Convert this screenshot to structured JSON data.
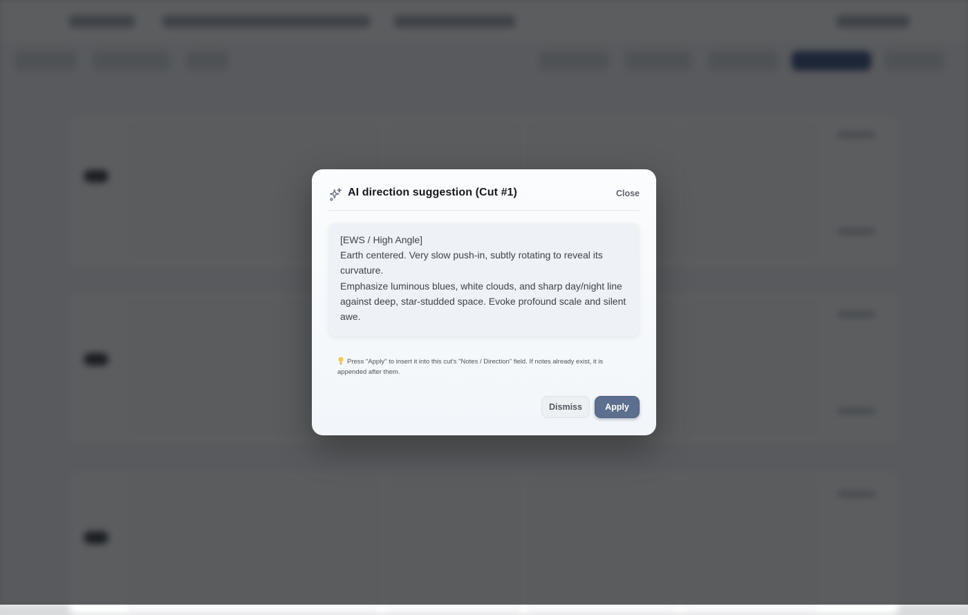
{
  "dialog": {
    "title": "AI direction suggestion (Cut #1)",
    "close_label": "Close",
    "suggestion_lines": [
      "[EWS / High Angle]",
      "Earth centered. Very slow push-in, subtly rotating to reveal its curvature.",
      "Emphasize luminous blues, white clouds, and sharp day/night line against deep, star-studded space. Evoke profound scale and silent awe."
    ],
    "hint_icon": "lightbulb-icon",
    "hint_text": "Press \"Apply\" to insert it into this cut's \"Notes / Direction\" field. If notes already exist, it is appended after them.",
    "dismiss_label": "Dismiss",
    "apply_label": "Apply"
  },
  "colors": {
    "overlay": "#1c1e21",
    "apply_button": "#5c6f8f",
    "title_text": "#15181c"
  },
  "icons": {
    "title_icon": "sparkles-icon"
  }
}
